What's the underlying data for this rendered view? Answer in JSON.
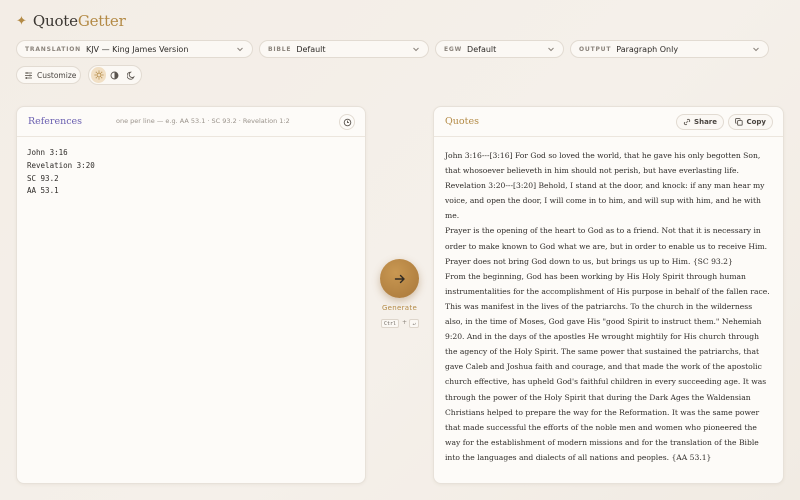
{
  "app": {
    "title_part1": "Quote",
    "title_part2": "Getter"
  },
  "selects": {
    "translation": {
      "label": "TRANSLATION",
      "value": "KJV — King James Version"
    },
    "bible": {
      "label": "BIBLE",
      "value": "Default"
    },
    "egw": {
      "label": "EGW",
      "value": "Default"
    },
    "output": {
      "label": "OUTPUT",
      "value": "Paragraph Only"
    }
  },
  "customize_label": "Customize",
  "theme_options": [
    "light",
    "auto",
    "dark"
  ],
  "theme_selected": "light",
  "references": {
    "title": "References",
    "hint": "one per line — e.g. AA 53.1 · SC 93.2 · Revelation 1:2",
    "lines": [
      "John 3:16",
      "Revelation 3:20",
      "SC 93.2",
      "AA 53.1"
    ]
  },
  "generate": {
    "label": "Generate",
    "shortcut_key1": "Ctrl",
    "shortcut_plus": "+",
    "shortcut_key2": "↵"
  },
  "quotes": {
    "title": "Quotes",
    "share_label": "Share",
    "copy_label": "Copy",
    "paragraphs": [
      "John 3:16---[3:16] For God so loved the world, that he gave his only begotten Son, that whosoever believeth in him should not perish, but have everlasting life.",
      "Revelation 3:20---[3:20] Behold, I stand at the door, and knock: if any man hear my voice, and open the door, I will come in to him, and will sup with him, and he with me.",
      "Prayer is the opening of the heart to God as to a friend. Not that it is necessary in order to make known to God what we are, but in order to enable us to receive Him. Prayer does not bring God down to us, but brings us up to Him.  {SC 93.2}",
      "From the beginning, God has been working by His Holy Spirit through human instrumentalities for the accomplishment of His purpose in behalf of the fallen race. This was manifest in the lives of the patriarchs. To the church in the wilderness also, in the time of Moses, God gave His \"good Spirit to instruct them.\" Nehemiah 9:20. And in the days of the apostles He wrought mightily for His church through the agency of the Holy Spirit. The same power that sustained the patriarchs, that gave Caleb and Joshua faith and courage, and that made the work of the apostolic church effective, has upheld God's faithful children in every succeeding age. It was through the power of the Holy Spirit that during the Dark Ages the Waldensian Christians helped to prepare the way for the Reformation. It was the same power that made successful the efforts of the noble men and women who pioneered the way for the establishment of modern missions and for the translation of the Bible into the languages and dialects of all nations and peoples.  {AA 53.1}"
    ]
  },
  "colors": {
    "accent": "#b38a45",
    "references_title": "#6a5fb0",
    "background": "#f3ede6"
  }
}
